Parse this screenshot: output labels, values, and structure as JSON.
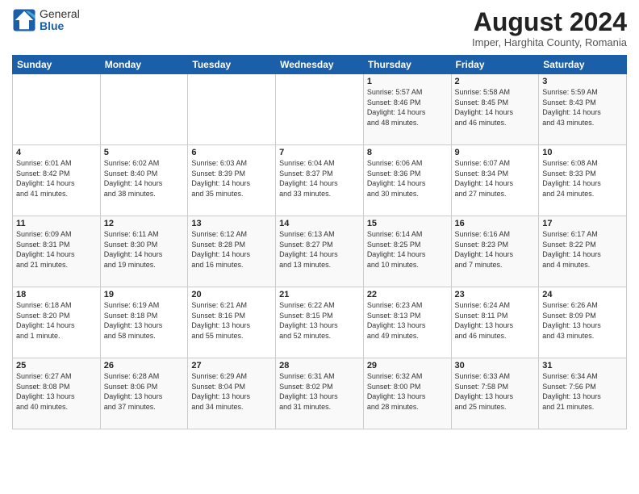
{
  "logo": {
    "general": "General",
    "blue": "Blue"
  },
  "title": "August 2024",
  "location": "Imper, Harghita County, Romania",
  "days_of_week": [
    "Sunday",
    "Monday",
    "Tuesday",
    "Wednesday",
    "Thursday",
    "Friday",
    "Saturday"
  ],
  "weeks": [
    [
      {
        "day": "",
        "info": ""
      },
      {
        "day": "",
        "info": ""
      },
      {
        "day": "",
        "info": ""
      },
      {
        "day": "",
        "info": ""
      },
      {
        "day": "1",
        "info": "Sunrise: 5:57 AM\nSunset: 8:46 PM\nDaylight: 14 hours\nand 48 minutes."
      },
      {
        "day": "2",
        "info": "Sunrise: 5:58 AM\nSunset: 8:45 PM\nDaylight: 14 hours\nand 46 minutes."
      },
      {
        "day": "3",
        "info": "Sunrise: 5:59 AM\nSunset: 8:43 PM\nDaylight: 14 hours\nand 43 minutes."
      }
    ],
    [
      {
        "day": "4",
        "info": "Sunrise: 6:01 AM\nSunset: 8:42 PM\nDaylight: 14 hours\nand 41 minutes."
      },
      {
        "day": "5",
        "info": "Sunrise: 6:02 AM\nSunset: 8:40 PM\nDaylight: 14 hours\nand 38 minutes."
      },
      {
        "day": "6",
        "info": "Sunrise: 6:03 AM\nSunset: 8:39 PM\nDaylight: 14 hours\nand 35 minutes."
      },
      {
        "day": "7",
        "info": "Sunrise: 6:04 AM\nSunset: 8:37 PM\nDaylight: 14 hours\nand 33 minutes."
      },
      {
        "day": "8",
        "info": "Sunrise: 6:06 AM\nSunset: 8:36 PM\nDaylight: 14 hours\nand 30 minutes."
      },
      {
        "day": "9",
        "info": "Sunrise: 6:07 AM\nSunset: 8:34 PM\nDaylight: 14 hours\nand 27 minutes."
      },
      {
        "day": "10",
        "info": "Sunrise: 6:08 AM\nSunset: 8:33 PM\nDaylight: 14 hours\nand 24 minutes."
      }
    ],
    [
      {
        "day": "11",
        "info": "Sunrise: 6:09 AM\nSunset: 8:31 PM\nDaylight: 14 hours\nand 21 minutes."
      },
      {
        "day": "12",
        "info": "Sunrise: 6:11 AM\nSunset: 8:30 PM\nDaylight: 14 hours\nand 19 minutes."
      },
      {
        "day": "13",
        "info": "Sunrise: 6:12 AM\nSunset: 8:28 PM\nDaylight: 14 hours\nand 16 minutes."
      },
      {
        "day": "14",
        "info": "Sunrise: 6:13 AM\nSunset: 8:27 PM\nDaylight: 14 hours\nand 13 minutes."
      },
      {
        "day": "15",
        "info": "Sunrise: 6:14 AM\nSunset: 8:25 PM\nDaylight: 14 hours\nand 10 minutes."
      },
      {
        "day": "16",
        "info": "Sunrise: 6:16 AM\nSunset: 8:23 PM\nDaylight: 14 hours\nand 7 minutes."
      },
      {
        "day": "17",
        "info": "Sunrise: 6:17 AM\nSunset: 8:22 PM\nDaylight: 14 hours\nand 4 minutes."
      }
    ],
    [
      {
        "day": "18",
        "info": "Sunrise: 6:18 AM\nSunset: 8:20 PM\nDaylight: 14 hours\nand 1 minute."
      },
      {
        "day": "19",
        "info": "Sunrise: 6:19 AM\nSunset: 8:18 PM\nDaylight: 13 hours\nand 58 minutes."
      },
      {
        "day": "20",
        "info": "Sunrise: 6:21 AM\nSunset: 8:16 PM\nDaylight: 13 hours\nand 55 minutes."
      },
      {
        "day": "21",
        "info": "Sunrise: 6:22 AM\nSunset: 8:15 PM\nDaylight: 13 hours\nand 52 minutes."
      },
      {
        "day": "22",
        "info": "Sunrise: 6:23 AM\nSunset: 8:13 PM\nDaylight: 13 hours\nand 49 minutes."
      },
      {
        "day": "23",
        "info": "Sunrise: 6:24 AM\nSunset: 8:11 PM\nDaylight: 13 hours\nand 46 minutes."
      },
      {
        "day": "24",
        "info": "Sunrise: 6:26 AM\nSunset: 8:09 PM\nDaylight: 13 hours\nand 43 minutes."
      }
    ],
    [
      {
        "day": "25",
        "info": "Sunrise: 6:27 AM\nSunset: 8:08 PM\nDaylight: 13 hours\nand 40 minutes."
      },
      {
        "day": "26",
        "info": "Sunrise: 6:28 AM\nSunset: 8:06 PM\nDaylight: 13 hours\nand 37 minutes."
      },
      {
        "day": "27",
        "info": "Sunrise: 6:29 AM\nSunset: 8:04 PM\nDaylight: 13 hours\nand 34 minutes."
      },
      {
        "day": "28",
        "info": "Sunrise: 6:31 AM\nSunset: 8:02 PM\nDaylight: 13 hours\nand 31 minutes."
      },
      {
        "day": "29",
        "info": "Sunrise: 6:32 AM\nSunset: 8:00 PM\nDaylight: 13 hours\nand 28 minutes."
      },
      {
        "day": "30",
        "info": "Sunrise: 6:33 AM\nSunset: 7:58 PM\nDaylight: 13 hours\nand 25 minutes."
      },
      {
        "day": "31",
        "info": "Sunrise: 6:34 AM\nSunset: 7:56 PM\nDaylight: 13 hours\nand 21 minutes."
      }
    ]
  ]
}
